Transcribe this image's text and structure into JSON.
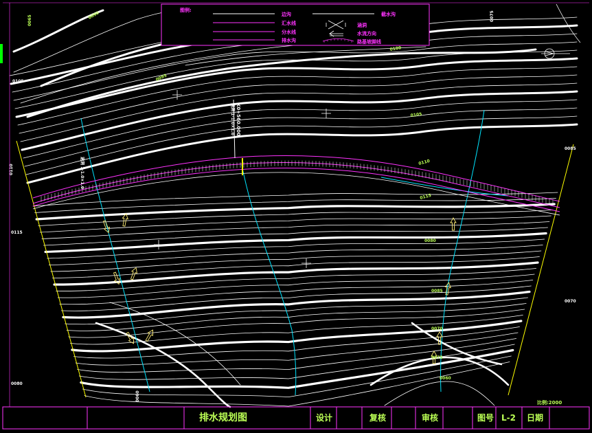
{
  "legend": {
    "title": "图例:",
    "items": [
      {
        "name": "边沟",
        "line": "solid-white",
        "color": "#ffffff"
      },
      {
        "name": "汇水线",
        "line": "solid-magenta",
        "color": "#ff33ff"
      },
      {
        "name": "分水线",
        "line": "solid-magenta",
        "color": "#ff33ff"
      },
      {
        "name": "排水沟",
        "line": "solid-magenta",
        "color": "#ff33ff"
      },
      {
        "name": "截水沟",
        "line": "solid-white",
        "color": "#ffffff"
      },
      {
        "name": "涵洞",
        "line": "culvert-symbol",
        "color": "#ff33ff"
      },
      {
        "name": "水流方向",
        "line": "arrow-symbol",
        "color": "#ff33ff"
      },
      {
        "name": "路基坡脚线",
        "line": "hatched",
        "color": "#ff33ff"
      }
    ]
  },
  "road_label": "K0+560.000",
  "road_label_sub": "涵洞 1-1.0×1.0",
  "contour_labels": [
    "0090",
    "0095",
    "0100",
    "0105",
    "0110",
    "0115",
    "0080",
    "0085",
    "0070",
    "0075",
    "0060",
    "0065"
  ],
  "title_block": {
    "drawing_name": "排水规划图",
    "design_label": "设计",
    "review_label": "复核",
    "audit_label": "审核",
    "drawing_no_label": "图号",
    "drawing_no": "L-2",
    "date_label": "日期",
    "scale": "比例:2000"
  },
  "colors": {
    "background": "#000000",
    "contour": "#ffffff",
    "frame": "#ff33ff",
    "yellow": "#ffff00",
    "cyan": "#00e5ff",
    "road": "#ff33ff",
    "label_green": "#bbff55",
    "green": "#00ff00"
  },
  "icons": [
    "north-arrow-icon",
    "culvert-icon",
    "flow-arrow-icon",
    "crosshair-icon"
  ]
}
